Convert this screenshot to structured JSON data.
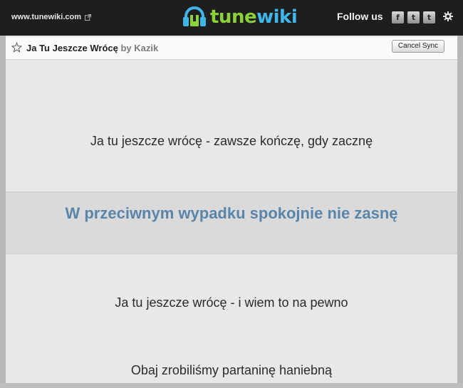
{
  "header": {
    "site_link": "www.tunewiki.com",
    "logo_part1": "tune",
    "logo_part2": "wiki",
    "follow_label": "Follow us",
    "social": [
      {
        "name": "facebook",
        "glyph": "f"
      },
      {
        "name": "twitter",
        "glyph": "t"
      },
      {
        "name": "tumblr",
        "glyph": "t"
      }
    ]
  },
  "song": {
    "title": "Ja Tu Jeszcze Wrócę",
    "by": "by Kazik",
    "cancel_label": "Cancel Sync"
  },
  "lyrics": {
    "lines": [
      "Ja tu jeszcze wrócę - zawsze kończę, gdy zacznę",
      "W przeciwnym wypadku spokojnie nie zasnę",
      "Ja tu jeszcze wrócę - i wiem to na pewno",
      "Obaj zrobiliśmy partaninę haniebną"
    ],
    "current_index": 1
  },
  "colors": {
    "header_bg": "#1e1e1e",
    "logo_green": "#8cd13a",
    "logo_blue": "#3fb6ea",
    "current_line": "#5a85ab"
  },
  "icons": [
    "external-link-icon",
    "headphones-logo-icon",
    "gear-icon",
    "star-icon"
  ]
}
